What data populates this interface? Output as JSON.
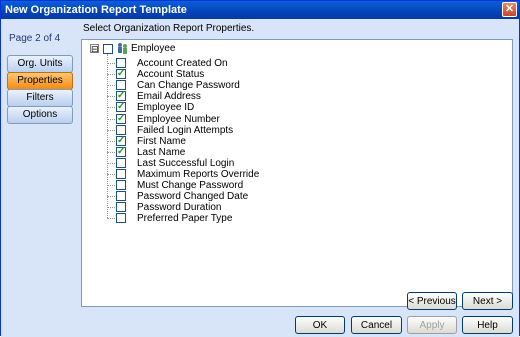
{
  "window": {
    "title": "New Organization Report Template",
    "close_glyph": "✕"
  },
  "sidebar": {
    "page_indicator": "Page 2 of 4",
    "items": [
      {
        "label": "Org. Units",
        "active": false
      },
      {
        "label": "Properties",
        "active": true
      },
      {
        "label": "Filters",
        "active": false
      },
      {
        "label": "Options",
        "active": false
      }
    ]
  },
  "main": {
    "instruction": "Select Organization Report Properties.",
    "tree": {
      "root": {
        "label": "Employee",
        "expander": "⊟",
        "icon": "employee-group-icon",
        "checked": false
      },
      "items": [
        {
          "label": "Account Created On",
          "checked": false
        },
        {
          "label": "Account Status",
          "checked": true
        },
        {
          "label": "Can Change Password",
          "checked": false
        },
        {
          "label": "Email Address",
          "checked": true
        },
        {
          "label": "Employee ID",
          "checked": true
        },
        {
          "label": "Employee Number",
          "checked": true
        },
        {
          "label": "Failed Login Attempts",
          "checked": false
        },
        {
          "label": "First Name",
          "checked": true
        },
        {
          "label": "Last Name",
          "checked": true
        },
        {
          "label": "Last Successful Login",
          "checked": false
        },
        {
          "label": "Maximum Reports Override",
          "checked": false
        },
        {
          "label": "Must Change Password",
          "checked": false
        },
        {
          "label": "Password Changed Date",
          "checked": false
        },
        {
          "label": "Password Duration",
          "checked": false
        },
        {
          "label": "Preferred Paper Type",
          "checked": false
        }
      ]
    }
  },
  "buttons": {
    "previous": "< Previous",
    "next": "Next >",
    "ok": "OK",
    "cancel": "Cancel",
    "apply": "Apply",
    "help": "Help"
  },
  "colors": {
    "active_nav": "#f38c12",
    "checkmark": "#21a121",
    "titlebar": "#0444b8"
  }
}
